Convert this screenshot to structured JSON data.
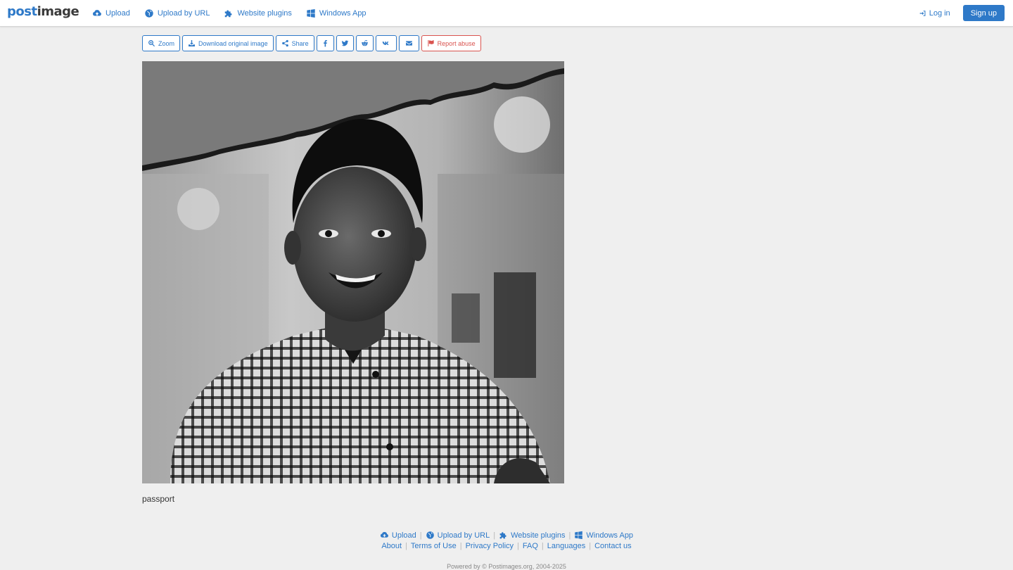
{
  "header": {
    "logo": {
      "part1": "post",
      "part2": "image"
    },
    "nav": [
      {
        "label": "Upload",
        "icon": "cloud-upload-icon"
      },
      {
        "label": "Upload by URL",
        "icon": "globe-icon"
      },
      {
        "label": "Website plugins",
        "icon": "puzzle-icon"
      },
      {
        "label": "Windows App",
        "icon": "windows-icon"
      }
    ],
    "login_label": "Log in",
    "signup_label": "Sign up"
  },
  "toolbar": {
    "zoom_label": "Zoom",
    "download_label": "Download original image",
    "share_label": "Share",
    "report_label": "Report abuse",
    "social_icons": [
      "facebook-icon",
      "twitter-icon",
      "reddit-icon",
      "vk-icon",
      "email-icon"
    ]
  },
  "image": {
    "caption": "passport"
  },
  "footer": {
    "row1": [
      {
        "label": "Upload",
        "icon": "cloud-upload-icon"
      },
      {
        "label": "Upload by URL",
        "icon": "globe-icon"
      },
      {
        "label": "Website plugins",
        "icon": "puzzle-icon"
      },
      {
        "label": "Windows App",
        "icon": "windows-icon"
      }
    ],
    "row2": [
      "About",
      "Terms of Use",
      "Privacy Policy",
      "FAQ",
      "Languages",
      "Contact us"
    ],
    "powered": "Powered by © Postimages.org, 2004-2025"
  },
  "colors": {
    "accent": "#2e79c8",
    "danger": "#d9534f",
    "background": "#efefef"
  }
}
